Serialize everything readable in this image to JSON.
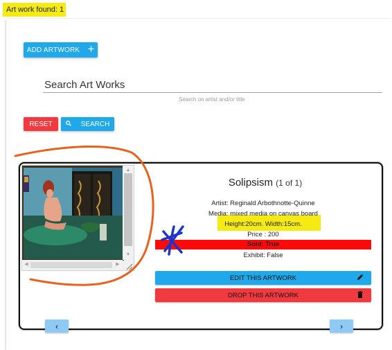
{
  "found": {
    "label": "Art work found: 1"
  },
  "toolbar": {
    "add_label": "ADD ARTWORK",
    "add_icon": "plus-icon"
  },
  "search": {
    "placeholder": "Search Art Works",
    "helper": "Search on artist and/or title",
    "reset_label": "RESET",
    "search_label": "SEARCH",
    "search_icon": "search-icon"
  },
  "artwork": {
    "title": "Solipsism",
    "counter": "(1 of 1)",
    "artist": "Artist: Reginald Arbothnotte-Quinne",
    "media": "Media: mixed media on canvas board",
    "dimensions": "Height:20cm. Width:15cm.",
    "price": "Price : 200",
    "sold": "Sold: True",
    "exhibit": "Exhibit: False"
  },
  "actions": {
    "edit_label": "EDIT THIS ARTWORK",
    "edit_icon": "pencil-icon",
    "drop_label": "DROP THIS ARTWORK",
    "drop_icon": "trash-icon"
  },
  "nav": {
    "prev": "‹",
    "next": "›"
  },
  "colors": {
    "primary_blue": "#1fa8ea",
    "danger_red": "#f03a40",
    "sold_red": "#ff0a0a",
    "highlight_yellow": "#f5ea14",
    "nav_blue": "#8fcaf6",
    "annotation_orange": "#e8621c",
    "annotation_blue": "#1a35c8"
  }
}
